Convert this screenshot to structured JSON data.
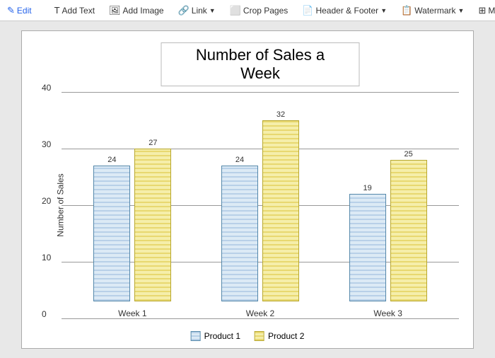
{
  "toolbar": {
    "edit_label": "Edit",
    "add_text_label": "Add Text",
    "add_image_label": "Add Image",
    "link_label": "Link",
    "crop_pages_label": "Crop Pages",
    "header_footer_label": "Header & Footer",
    "watermark_label": "Watermark",
    "more_label": "More"
  },
  "chart": {
    "title": "Number of Sales a Week",
    "y_axis_label": "Number of Sales",
    "y_axis_max": 40,
    "grid_lines": [
      {
        "value": 40,
        "pct": 100
      },
      {
        "value": 30,
        "pct": 75
      },
      {
        "value": 20,
        "pct": 50
      },
      {
        "value": 10,
        "pct": 25
      },
      {
        "value": 0,
        "pct": 0
      }
    ],
    "weeks": [
      {
        "label": "Week 1",
        "product1": {
          "value": 24,
          "height_pct": 60
        },
        "product2": {
          "value": 27,
          "height_pct": 67.5
        }
      },
      {
        "label": "Week 2",
        "product1": {
          "value": 24,
          "height_pct": 60
        },
        "product2": {
          "value": 32,
          "height_pct": 80
        }
      },
      {
        "label": "Week 3",
        "product1": {
          "value": 19,
          "height_pct": 47.5
        },
        "product2": {
          "value": 25,
          "height_pct": 62.5
        }
      }
    ],
    "legend": [
      {
        "label": "Product 1",
        "class": "legend-box-p1"
      },
      {
        "label": "Product 2",
        "class": "legend-box-p2"
      }
    ]
  }
}
